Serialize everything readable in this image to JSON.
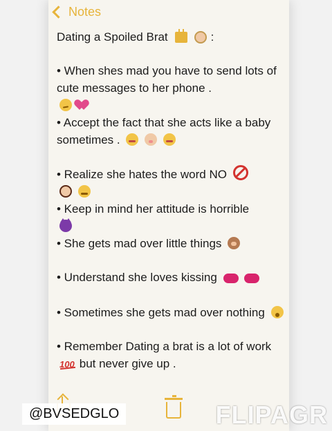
{
  "nav": {
    "back_label": "Notes"
  },
  "note": {
    "title": "Dating a Spoiled Brat",
    "title_suffix": ":",
    "items": [
      "• When shes mad you have to send lots of cute messages to her phone .",
      "• Accept the fact that she acts like a baby sometimes .",
      "• Realize she hates the word NO",
      "• Keep in mind her attitude is horrible",
      "• She gets mad over little things",
      "• Understand she loves kissing",
      "• Sometimes she gets mad over nothing",
      "• Remember Dating a brat is a lot of work",
      "but never give up ."
    ]
  },
  "overlays": {
    "handle": "@BVSEDGLO",
    "watermark": "FLIPAGR"
  },
  "icons": {
    "title_icons": [
      "crown-icon",
      "princess-icon"
    ],
    "item_1_icons": [
      "smirk-icon",
      "heart-icon"
    ],
    "item_2_icons": [
      "blush-icon",
      "baby-icon",
      "blush-icon"
    ],
    "item_3_icons": [
      "no-entry-icon",
      "girl-icon",
      "steam-face-icon"
    ],
    "item_4_icons": [
      "devil-icon"
    ],
    "item_5_icons": [
      "monkey-icon"
    ],
    "item_6_icons": [
      "lips-icon",
      "lips-icon"
    ],
    "item_7_icons": [
      "weary-face-icon"
    ],
    "item_8_icons": [
      "hundred-icon"
    ]
  },
  "colors": {
    "accent": "#e7b43b",
    "paper": "#f7f5ef",
    "text": "#1c1c1c"
  }
}
